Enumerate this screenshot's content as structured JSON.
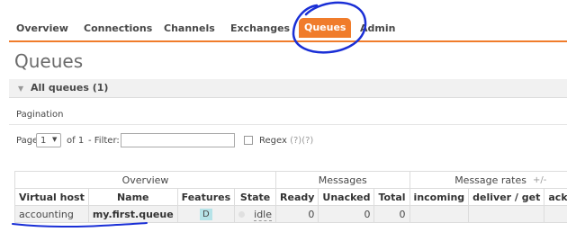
{
  "nav": {
    "items": [
      {
        "label": "Overview",
        "active": false
      },
      {
        "label": "Connections",
        "active": false
      },
      {
        "label": "Channels",
        "active": false
      },
      {
        "label": "Exchanges",
        "active": false
      },
      {
        "label": "Queues",
        "active": true
      },
      {
        "label": "Admin",
        "active": false
      }
    ]
  },
  "page": {
    "title": "Queues"
  },
  "section": {
    "label": "All queues (1)"
  },
  "pagination": {
    "label": "Pagination",
    "page_label": "Page",
    "page_value": "1",
    "of_label": "of 1",
    "filter_label": "- Filter:",
    "filter_value": "",
    "regex_label": "Regex",
    "regex_help": "(?)(?)"
  },
  "table": {
    "groups": [
      "Overview",
      "Messages",
      "Message rates"
    ],
    "columns": [
      "Virtual host",
      "Name",
      "Features",
      "State",
      "Ready",
      "Unacked",
      "Total",
      "incoming",
      "deliver / get",
      "ack"
    ],
    "rows": [
      {
        "vhost": "accounting",
        "name": "my.first.queue",
        "features": "D",
        "state": "idle",
        "ready": "0",
        "unacked": "0",
        "total": "0",
        "incoming": "",
        "deliver": "",
        "ack": ""
      }
    ],
    "add_remove": "+/-"
  },
  "colors": {
    "accent": "#f07c2b",
    "annotation": "#1a2fd6"
  }
}
